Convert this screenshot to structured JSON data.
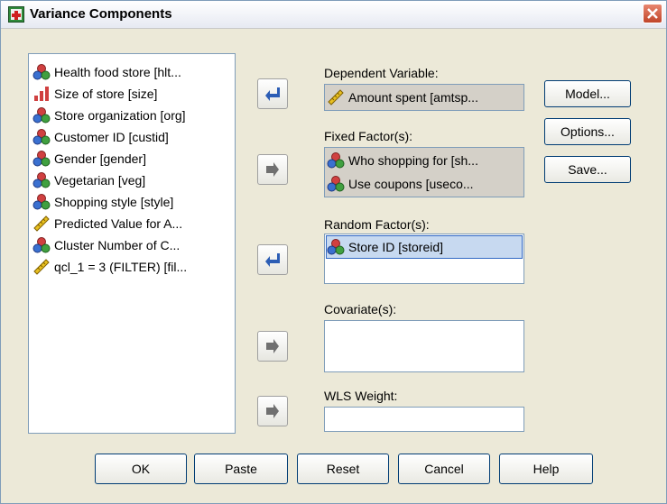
{
  "window": {
    "title": "Variance Components",
    "icon": "spss-dialog-icon",
    "close_icon": "close-icon"
  },
  "source_variables": [
    {
      "label": "Health food store [hlt...",
      "icon": "nominal-icon"
    },
    {
      "label": "Size of store [size]",
      "icon": "ordinal-icon"
    },
    {
      "label": "Store organization [org]",
      "icon": "nominal-icon"
    },
    {
      "label": "Customer ID [custid]",
      "icon": "nominal-icon"
    },
    {
      "label": "Gender [gender]",
      "icon": "nominal-icon"
    },
    {
      "label": "Vegetarian [veg]",
      "icon": "nominal-icon"
    },
    {
      "label": "Shopping style [style]",
      "icon": "nominal-icon"
    },
    {
      "label": "Predicted Value for A...",
      "icon": "scale-icon"
    },
    {
      "label": "Cluster Number of C...",
      "icon": "nominal-icon"
    },
    {
      "label": "qcl_1 = 3 (FILTER) [fil...",
      "icon": "scale-icon"
    }
  ],
  "dependent": {
    "label": "Dependent Variable:",
    "value": "Amount spent [amtsp..."
  },
  "fixed": {
    "label": "Fixed Factor(s):",
    "items": [
      "Who shopping for [sh...",
      "Use coupons [useco..."
    ]
  },
  "random": {
    "label": "Random Factor(s):",
    "items": [
      "Store ID [storeid]"
    ]
  },
  "covariates": {
    "label": "Covariate(s):"
  },
  "wls": {
    "label": "WLS Weight:"
  },
  "side_buttons": {
    "model": "Model...",
    "options": "Options...",
    "save": "Save..."
  },
  "bottom_buttons": {
    "ok": "OK",
    "paste": "Paste",
    "reset": "Reset",
    "cancel": "Cancel",
    "help": "Help"
  },
  "colors": {
    "accent": "#3168c3",
    "nominal": "#d04040",
    "scale": "#c8a000",
    "background": "#ece9d8"
  }
}
